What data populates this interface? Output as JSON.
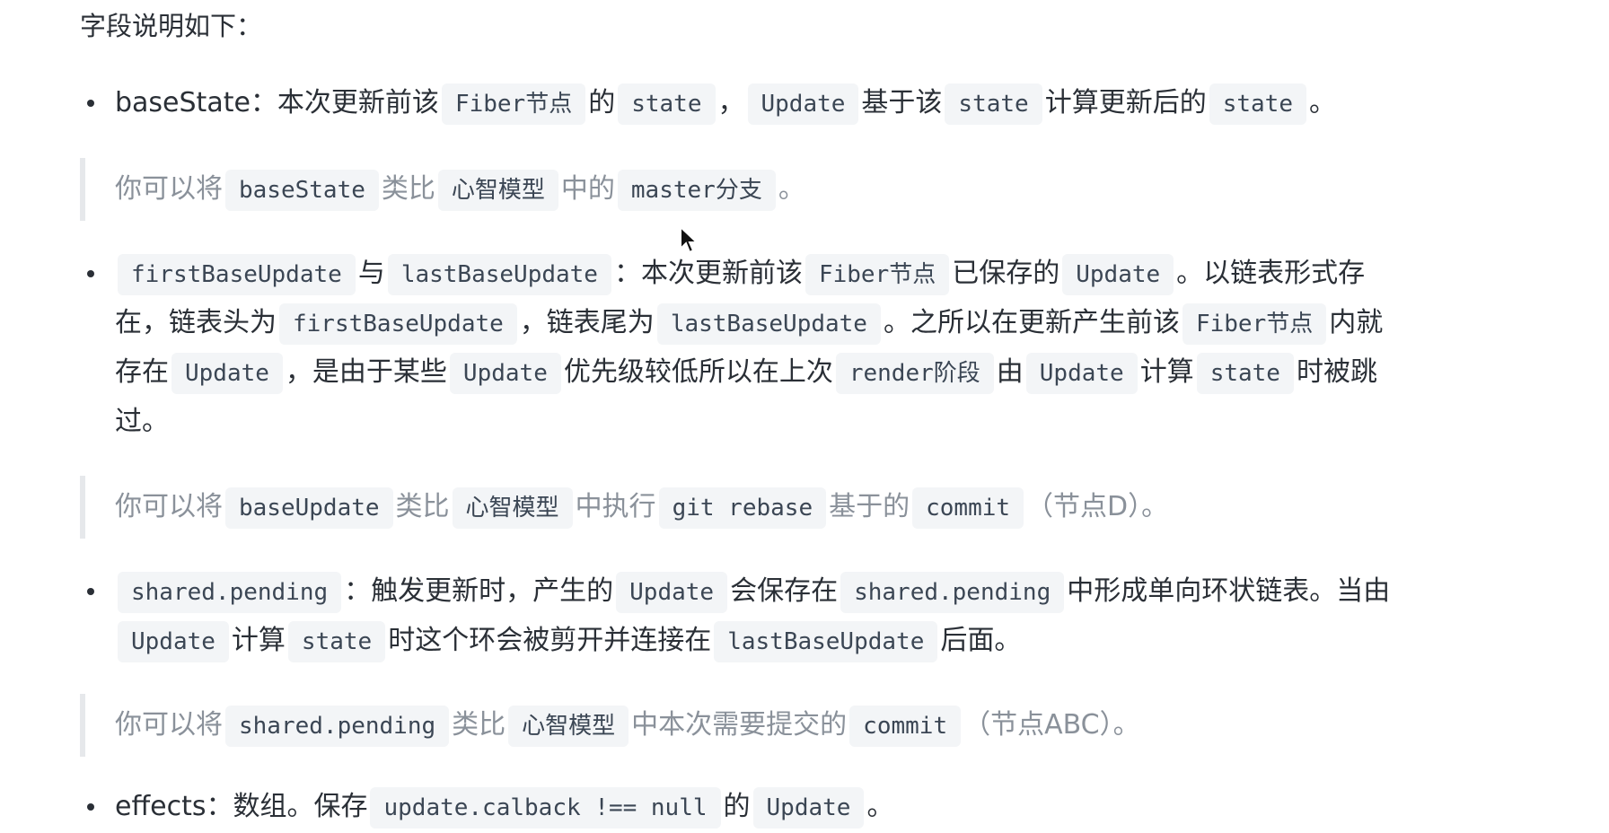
{
  "intro": "字段说明如下：",
  "items": [
    {
      "segments": [
        {
          "t": "text",
          "v": "baseState：本次更新前该"
        },
        {
          "t": "code",
          "v": "Fiber节点"
        },
        {
          "t": "text",
          "v": "的"
        },
        {
          "t": "code",
          "v": "state"
        },
        {
          "t": "text",
          "v": "，"
        },
        {
          "t": "code",
          "v": "Update"
        },
        {
          "t": "text",
          "v": "基于该"
        },
        {
          "t": "code",
          "v": "state"
        },
        {
          "t": "text",
          "v": "计算更新后的"
        },
        {
          "t": "code",
          "v": "state"
        },
        {
          "t": "text",
          "v": "。"
        }
      ],
      "quote": [
        {
          "t": "text",
          "v": "你可以将"
        },
        {
          "t": "code",
          "v": "baseState"
        },
        {
          "t": "text",
          "v": "类比"
        },
        {
          "t": "code",
          "v": "心智模型"
        },
        {
          "t": "text",
          "v": "中的"
        },
        {
          "t": "code",
          "v": "master分支"
        },
        {
          "t": "text",
          "v": "。"
        }
      ]
    },
    {
      "segments": [
        {
          "t": "code",
          "v": "firstBaseUpdate"
        },
        {
          "t": "text",
          "v": "与"
        },
        {
          "t": "code",
          "v": "lastBaseUpdate"
        },
        {
          "t": "text",
          "v": "：本次更新前该"
        },
        {
          "t": "code",
          "v": "Fiber节点"
        },
        {
          "t": "text",
          "v": "已保存的"
        },
        {
          "t": "code",
          "v": "Update"
        },
        {
          "t": "text",
          "v": "。以链表形式存在，链表头为"
        },
        {
          "t": "code",
          "v": "firstBaseUpdate"
        },
        {
          "t": "text",
          "v": "，链表尾为"
        },
        {
          "t": "code",
          "v": "lastBaseUpdate"
        },
        {
          "t": "text",
          "v": "。之所以在更新产生前该"
        },
        {
          "t": "code",
          "v": "Fiber节点"
        },
        {
          "t": "text",
          "v": "内就存在"
        },
        {
          "t": "code",
          "v": "Update"
        },
        {
          "t": "text",
          "v": "，是由于某些"
        },
        {
          "t": "code",
          "v": "Update"
        },
        {
          "t": "text",
          "v": "优先级较低所以在上次"
        },
        {
          "t": "code",
          "v": "render阶段"
        },
        {
          "t": "text",
          "v": "由"
        },
        {
          "t": "code",
          "v": "Update"
        },
        {
          "t": "text",
          "v": "计算"
        },
        {
          "t": "code",
          "v": "state"
        },
        {
          "t": "text",
          "v": "时被跳过。"
        }
      ],
      "quote": [
        {
          "t": "text",
          "v": "你可以将"
        },
        {
          "t": "code",
          "v": "baseUpdate"
        },
        {
          "t": "text",
          "v": "类比"
        },
        {
          "t": "code",
          "v": "心智模型"
        },
        {
          "t": "text",
          "v": "中执行"
        },
        {
          "t": "code",
          "v": "git rebase"
        },
        {
          "t": "text",
          "v": "基于的"
        },
        {
          "t": "code",
          "v": "commit"
        },
        {
          "t": "text",
          "v": "（节点D）。"
        }
      ]
    },
    {
      "segments": [
        {
          "t": "code",
          "v": "shared.pending"
        },
        {
          "t": "text",
          "v": "：触发更新时，产生的"
        },
        {
          "t": "code",
          "v": "Update"
        },
        {
          "t": "text",
          "v": "会保存在"
        },
        {
          "t": "code",
          "v": "shared.pending"
        },
        {
          "t": "text",
          "v": "中形成单向环状链表。当由"
        },
        {
          "t": "code",
          "v": "Update"
        },
        {
          "t": "text",
          "v": "计算"
        },
        {
          "t": "code",
          "v": "state"
        },
        {
          "t": "text",
          "v": "时这个环会被剪开并连接在"
        },
        {
          "t": "code",
          "v": "lastBaseUpdate"
        },
        {
          "t": "text",
          "v": "后面。"
        }
      ],
      "quote": [
        {
          "t": "text",
          "v": "你可以将"
        },
        {
          "t": "code",
          "v": "shared.pending"
        },
        {
          "t": "text",
          "v": "类比"
        },
        {
          "t": "code",
          "v": "心智模型"
        },
        {
          "t": "text",
          "v": "中本次需要提交的"
        },
        {
          "t": "code",
          "v": "commit"
        },
        {
          "t": "text",
          "v": "（节点ABC）。"
        }
      ]
    },
    {
      "segments": [
        {
          "t": "text",
          "v": "effects：数组。保存"
        },
        {
          "t": "code",
          "v": "update.calback !== null"
        },
        {
          "t": "text",
          "v": "的"
        },
        {
          "t": "code",
          "v": "Update"
        },
        {
          "t": "text",
          "v": "。"
        }
      ],
      "quote": null
    }
  ]
}
